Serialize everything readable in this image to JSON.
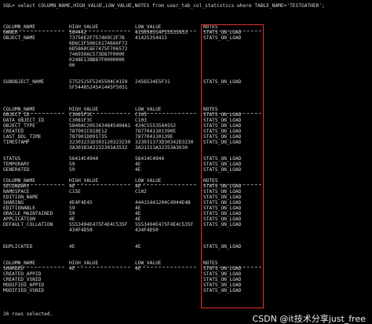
{
  "command": "SQL> select COLUMN_NAME,HIGH_VALUE,LOW_VALUE,NOTES from user_tab_col_statistics where TABLE_NAME='TESTGATHER';",
  "header": [
    "COLUMN_NAME",
    "HIGH_VALUE",
    "LOW_VALUE",
    "NOTES"
  ],
  "rows": [
    [
      "COLUMN_NAME",
      "HIGH_VALUE",
      "LOW_VALUE",
      "NOTES"
    ],
    [
      "OWNER",
      "584442",
      "415050514F53535953",
      "STATS_ON_LOAD"
    ],
    [
      "OBJECT_NAME",
      "73756E2F757469C2F7B",
      "41425354415",
      "STATS_ON_LOAD"
    ],
    [
      "",
      "6D6C2F506C6174666F72",
      "",
      ""
    ],
    [
      "",
      "6D5860C6E7475F706572",
      "",
      ""
    ],
    [
      "",
      "746930AC573D87F0000",
      "",
      ""
    ],
    [
      "",
      "0248E13BB87F0000000",
      "",
      ""
    ],
    [
      "",
      "00",
      "",
      ""
    ],
    [
      "",
      "",
      "",
      ""
    ],
    [
      "",
      "",
      "",
      ""
    ],
    [
      "SUBOBJECT_NAME",
      "5752525F5245504C4159",
      "2456534E5F31",
      "STATS_ON_LOAD"
    ],
    [
      "",
      "5F5448524541445F5031",
      "",
      ""
    ],
    [
      "",
      "",
      "",
      ""
    ],
    [
      "",
      "",
      "",
      ""
    ],
    [
      "",
      "",
      "",
      ""
    ],
    [
      "COLUMN_NAME",
      "HIGH_VALUE",
      "LOW_VALUE",
      "NOTES"
    ],
    [
      "OBJECT_ID",
      "C3081F3C",
      "C103",
      "STATS_ON_LOAD"
    ],
    [
      "DATA_OBJECT_ID",
      "C3081F3C",
      "C103",
      "STATS_ON_LOAD"
    ],
    [
      "OBJECT_TYPE",
      "5840AC2053434845404A1",
      "434C5553544552",
      "STATS_ON_LOAD"
    ],
    [
      "CREATED",
      "787901C010E12",
      "7877041101390E",
      "STATS_ON_LOAD"
    ],
    [
      "LAST_DDL_TIME",
      "787901D091735",
      "787704110139E",
      "STATS_ON_LOAD"
    ],
    [
      "TIMESTAMP",
      "32303231D303120323230",
      "323031373D30342D3230",
      "STATS_ON_LOAD"
    ],
    [
      "",
      "3A30383A3232303A3532",
      "3A31313A32353A3030",
      ""
    ],
    [
      "",
      "",
      "",
      ""
    ],
    [
      "STATUS",
      "56414C4944",
      "56414C4944",
      "STATS_ON_LOAD"
    ],
    [
      "TEMPORARY",
      "59",
      "4E",
      "STATS_ON_LOAD"
    ],
    [
      "GENERATED",
      "59",
      "4E",
      "STATS_ON_LOAD"
    ],
    [
      "",
      "",
      "",
      ""
    ],
    [
      "COLUMN_NAME",
      "HIGH_VALUE",
      "LOW_VALUE",
      "NOTES"
    ],
    [
      "SECONDARY",
      "4E",
      "4E",
      "STATS_ON_LOAD"
    ],
    [
      "NAMESPACE",
      "C15E",
      "C102",
      "STATS_ON_LOAD"
    ],
    [
      "EDITION_NAME",
      "",
      "",
      "STATS_ON_LOAD"
    ],
    [
      "SHARING",
      "4E4F4E45",
      "44415441204C4944E4B",
      "STATS_ON_LOAD"
    ],
    [
      "EDITIONABLE",
      "59",
      "4E",
      "STATS_ON_LOAD"
    ],
    [
      "ORACLE_MAINTAINED",
      "59",
      "4E",
      "STATS_ON_LOAD"
    ],
    [
      "APPLICATION",
      "4E",
      "4E",
      "STATS_ON_LOAD"
    ],
    [
      "DEFAULT_COLLATION",
      "5553494E475F4E4C535F",
      "5553494E475F4E4C535F",
      "STATS_ON_LOAD"
    ],
    [
      "",
      "434F4D50",
      "434F4D50",
      ""
    ],
    [
      "",
      "",
      "",
      ""
    ],
    [
      "",
      "",
      "",
      ""
    ],
    [
      "DUPLICATED",
      "4E",
      "4E",
      "STATS_ON_LOAD"
    ],
    [
      "",
      "",
      "",
      ""
    ],
    [
      "",
      "",
      "",
      ""
    ],
    [
      "COLUMN_NAME",
      "HIGH_VALUE",
      "LOW_VALUE",
      "NOTES"
    ],
    [
      "SHARDED",
      "4E",
      "4E",
      "STATS_ON_LOAD"
    ],
    [
      "CREATED_APPID",
      "",
      "",
      "STATS_ON_LOAD"
    ],
    [
      "CREATED_VSNID",
      "",
      "",
      "STATS_ON_LOAD"
    ],
    [
      "MODIFIED_APPID",
      "",
      "",
      "STATS_ON_LOAD"
    ],
    [
      "MODIFIED_VSNID",
      "",
      "",
      "STATS_ON_LOAD"
    ]
  ],
  "footer": "26 rows selected.",
  "watermark": "CSDN @it技术分享just_free",
  "colors": {
    "background": "#000000",
    "text": "#d8d8d8",
    "highlight": "#e03030"
  }
}
